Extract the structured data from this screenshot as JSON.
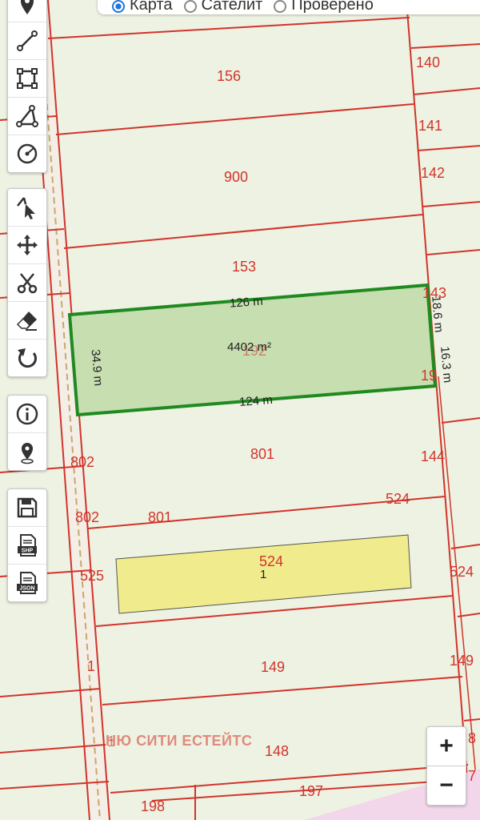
{
  "layer_switcher": {
    "options": [
      {
        "label": "Карта",
        "selected": true
      },
      {
        "label": "Сателит",
        "selected": false
      },
      {
        "label": "Проверено",
        "selected": false
      }
    ]
  },
  "toolbar_groups": [
    {
      "tools": [
        {
          "name": "marker-icon"
        },
        {
          "name": "line-tool-icon"
        },
        {
          "name": "polygon-tool-icon"
        },
        {
          "name": "angle-tool-icon"
        },
        {
          "name": "circle-tool-icon"
        }
      ]
    },
    {
      "tools": [
        {
          "name": "select-vertex-icon"
        },
        {
          "name": "move-icon"
        },
        {
          "name": "cut-icon"
        },
        {
          "name": "eraser-icon"
        },
        {
          "name": "undo-icon"
        }
      ]
    },
    {
      "tools": [
        {
          "name": "info-icon"
        },
        {
          "name": "location-pin-icon"
        }
      ]
    },
    {
      "tools": [
        {
          "name": "save-icon"
        },
        {
          "name": "export-shp-icon",
          "label": "SHP"
        },
        {
          "name": "export-json-icon",
          "label": "JSON"
        }
      ]
    }
  ],
  "parcels": {
    "p156": "156",
    "p140": "140",
    "p900": "900",
    "p141": "141",
    "p142": "142",
    "p153": "153",
    "p143": "143",
    "p192": "192",
    "p19": "19",
    "p801a": "801",
    "p802a": "802",
    "p144": "144",
    "p524a": "524",
    "p802b": "802",
    "p801b": "801",
    "p525": "525",
    "p524b": "524",
    "p524c": "524",
    "p1a": "1",
    "p149a": "149",
    "p149b": "149",
    "p148": "148",
    "p1b": "1",
    "p198": "198",
    "p197": "197",
    "p8": "8",
    "p7": "7"
  },
  "measurements": {
    "top": "126 m",
    "bottom": "124 m",
    "left": "34.9 m",
    "right_upper": "18.6 m",
    "right_lower": "16.3 m",
    "area": "4402 m²"
  },
  "highlight_label": "1",
  "watermark": "НЮ СИТИ ЕСТЕЙТС",
  "zoom": {
    "in": "+",
    "out": "−"
  },
  "colors": {
    "background": "#eef2e2",
    "parcel_border": "#d1342a",
    "selected_fill": "#c7deb0",
    "selected_stroke": "#1f8a1f",
    "highlight_fill": "#f0eb8c"
  }
}
